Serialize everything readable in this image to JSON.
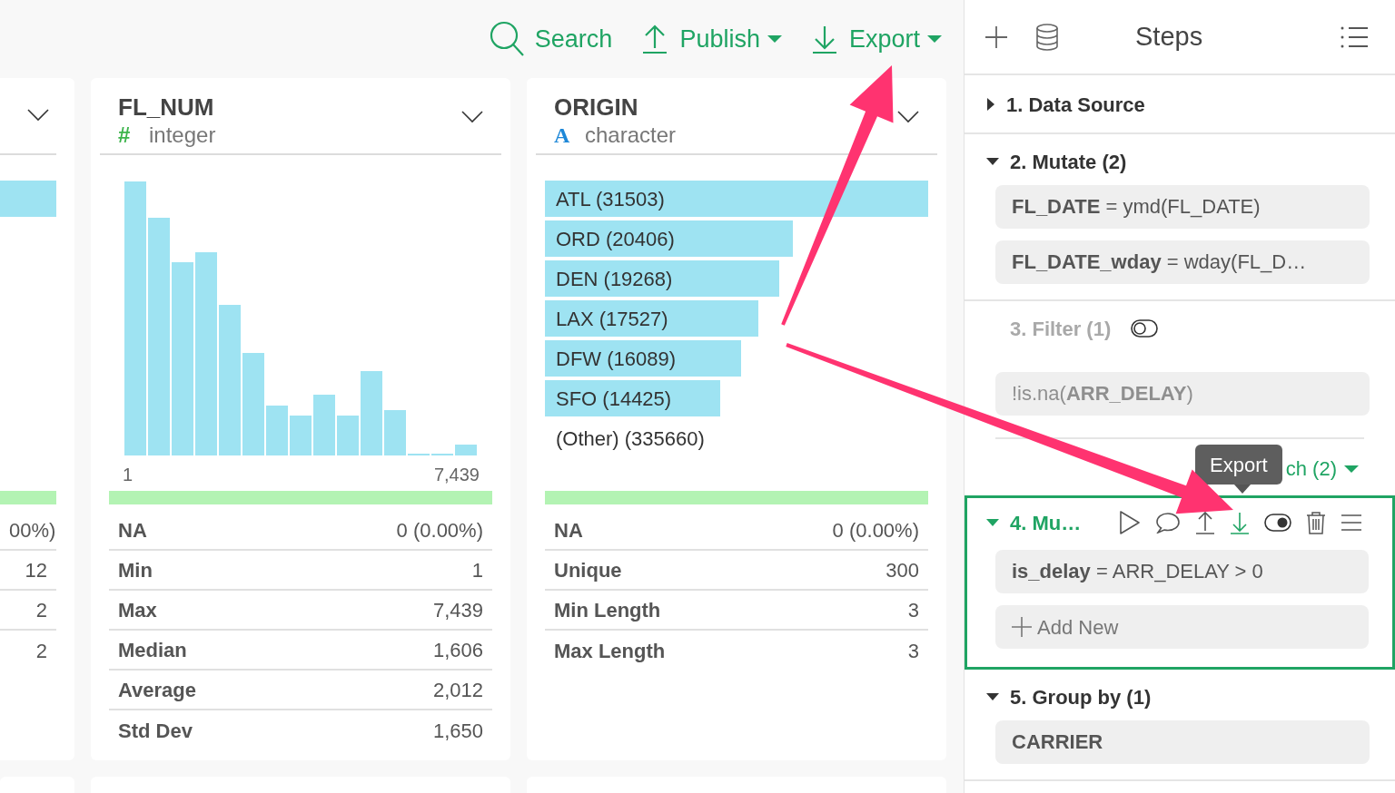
{
  "toolbar": {
    "buttons": [
      {
        "kind": "search",
        "label": "Search"
      },
      {
        "kind": "publish",
        "label": "Publish",
        "dropdown": true
      },
      {
        "kind": "export",
        "label": "Export",
        "dropdown": true
      }
    ]
  },
  "columns": [
    {
      "kind": "partial",
      "categories": [
        {
          "level": 1
        }
      ],
      "quality_bar": {
        "level": 1
      },
      "stats": [
        {
          "value": "00%)"
        },
        {
          "value": "12"
        },
        {
          "value": "2"
        },
        {
          "value": "2"
        }
      ]
    },
    {
      "kind": "numeric",
      "name": "FL_NUM",
      "type_icon": "#",
      "type": "integer",
      "axis": {
        "min": "1",
        "max": "7,439"
      },
      "quality_bar": {
        "level": 1
      },
      "stats": [
        {
          "label": "NA",
          "value": "0 (0.00%)"
        },
        {
          "label": "Min",
          "value": "1"
        },
        {
          "label": "Max",
          "value": "7,439"
        },
        {
          "label": "Median",
          "value": "1,606"
        },
        {
          "label": "Average",
          "value": "2,012"
        },
        {
          "label": "Std Dev",
          "value": "1,650"
        }
      ]
    },
    {
      "kind": "categorical",
      "name": "ORIGIN",
      "type_icon": "A",
      "type": "character",
      "categories": [
        {
          "label": "ATL (31503)",
          "level": 1
        },
        {
          "label": "ORD (20406)",
          "level": 0.648
        },
        {
          "label": "DEN (19268)",
          "level": 0.612
        },
        {
          "label": "LAX (17527)",
          "level": 0.556
        },
        {
          "label": "DFW (16089)",
          "level": 0.511
        },
        {
          "label": "SFO (14425)",
          "level": 0.458
        },
        {
          "label": "(Other) (335660)"
        }
      ],
      "quality_bar": {
        "level": 1
      },
      "stats": [
        {
          "label": "NA",
          "value": "0 (0.00%)"
        },
        {
          "label": "Unique",
          "value": "300"
        },
        {
          "label": "Min Length",
          "value": "3"
        },
        {
          "label": "Max Length",
          "value": "3"
        }
      ]
    }
  ],
  "steps_panel": {
    "title": "Steps",
    "steps": [
      {
        "title": "1. Data Source",
        "expanded": false,
        "disabled": false,
        "selected": false
      },
      {
        "title": "2. Mutate (2)",
        "expanded": true,
        "disabled": false,
        "selected": false,
        "items": [
          {
            "kind": "expression",
            "text": "**FL_DATE** = ymd(FL_DATE)"
          },
          {
            "kind": "expression",
            "text": "**FL_DATE_wday** = wday(FL_D…"
          }
        ]
      },
      {
        "title": "3. Filter (1)",
        "disabled": true,
        "selected": false,
        "toggle": {
          "on": false
        },
        "items": [
          {
            "kind": "expression",
            "text": "!is.na(**ARR_DELAY**)"
          }
        ],
        "branch": {
          "label": "ch (2)"
        }
      },
      {
        "title": "4. Mu…",
        "expanded": true,
        "disabled": false,
        "selected": true,
        "actions": [
          {
            "kind": "run",
            "highlighted": false
          },
          {
            "kind": "comment",
            "highlighted": false
          },
          {
            "kind": "publish",
            "highlighted": false
          },
          {
            "kind": "export",
            "highlighted": true
          },
          {
            "kind": "toggle",
            "on": true,
            "highlighted": false
          },
          {
            "kind": "delete",
            "highlighted": false
          },
          {
            "kind": "menu",
            "highlighted": false
          }
        ],
        "items": [
          {
            "kind": "expression",
            "text": "**is_delay** = ARR_DELAY > 0"
          }
        ],
        "add_new": {
          "label": "Add New"
        }
      },
      {
        "title": "5. Group by (1)",
        "expanded": true,
        "disabled": false,
        "selected": false,
        "items": [
          {
            "kind": "group_key",
            "text": "CARRIER"
          }
        ]
      }
    ]
  },
  "tooltip": {
    "text": "Export"
  }
}
